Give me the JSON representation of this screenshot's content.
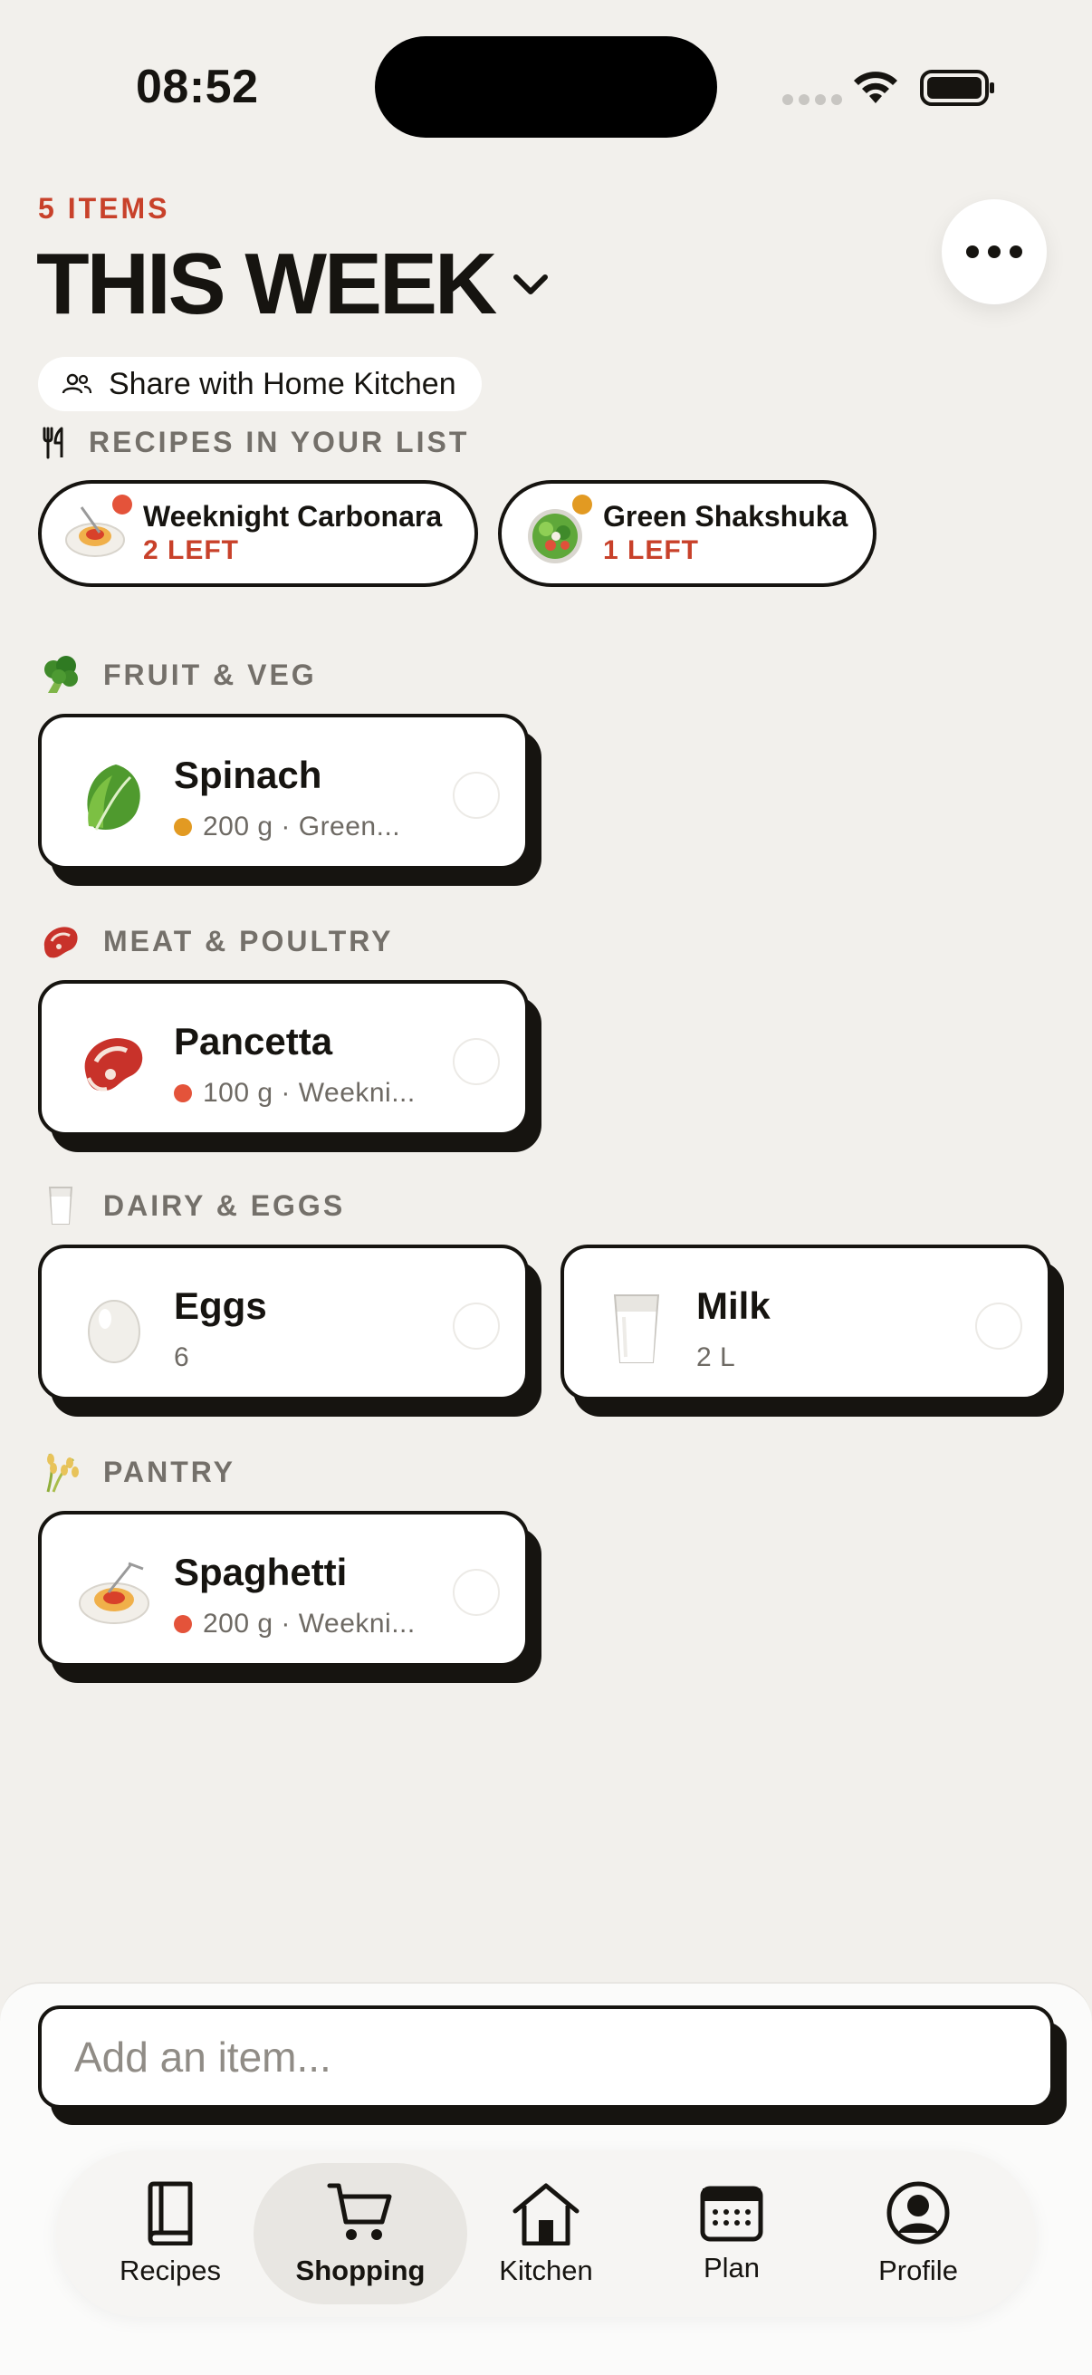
{
  "status_bar": {
    "time": "08:52"
  },
  "header": {
    "items_count": "5 ITEMS",
    "title": "THIS WEEK",
    "share_label": "Share with Home Kitchen"
  },
  "recipes_section": {
    "heading": "RECIPES IN YOUR LIST",
    "recipes": [
      {
        "name": "Weeknight Carbonara",
        "left": "2 LEFT",
        "dot_color": "#e4533a",
        "icon": "spaghetti-icon"
      },
      {
        "name": "Green Shakshuka",
        "left": "1 LEFT",
        "dot_color": "#e29a22",
        "icon": "salad-icon"
      }
    ]
  },
  "sections": [
    {
      "heading": "FRUIT & VEG",
      "icon": "broccoli-icon",
      "items": [
        {
          "name": "Spinach",
          "meta": "200 g · Green...",
          "dot_color": "#e29a22",
          "icon": "leafy-green-icon"
        }
      ]
    },
    {
      "heading": "MEAT & POULTRY",
      "icon": "meat-icon",
      "items": [
        {
          "name": "Pancetta",
          "meta": "100 g · Weekni...",
          "dot_color": "#e4533a",
          "icon": "steak-icon"
        }
      ]
    },
    {
      "heading": "DAIRY & EGGS",
      "icon": "milk-glass-icon",
      "items": [
        {
          "name": "Eggs",
          "meta": "6",
          "icon": "egg-icon"
        },
        {
          "name": "Milk",
          "meta": "2 L",
          "icon": "milk-glass-icon"
        }
      ]
    },
    {
      "heading": "PANTRY",
      "icon": "rice-icon",
      "items": [
        {
          "name": "Spaghetti",
          "meta": "200 g · Weekni...",
          "dot_color": "#e4533a",
          "icon": "spaghetti-icon"
        }
      ]
    }
  ],
  "add_item": {
    "placeholder": "Add an item..."
  },
  "tab_bar": {
    "tabs": [
      {
        "label": "Recipes",
        "icon": "book-icon"
      },
      {
        "label": "Shopping",
        "icon": "cart-icon",
        "active": true
      },
      {
        "label": "Kitchen",
        "icon": "home-icon"
      },
      {
        "label": "Plan",
        "icon": "calendar-icon"
      },
      {
        "label": "Profile",
        "icon": "profile-icon"
      }
    ]
  },
  "colors": {
    "accent": "#c8412a",
    "background": "#f2f0ec",
    "ink": "#161410"
  }
}
